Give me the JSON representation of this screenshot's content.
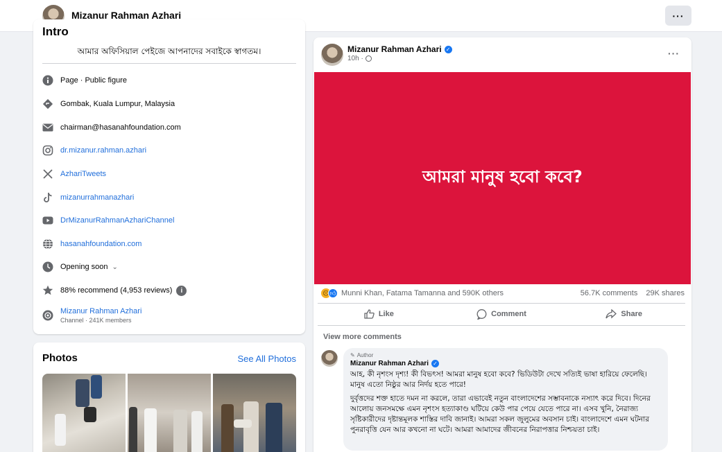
{
  "header": {
    "page_name": "Mizanur Rahman Azhari",
    "more_label": "···"
  },
  "intro": {
    "title": "Intro",
    "bio": "আমার অফিসিয়াল পেইজে আপনাদের সবাইকে স্বাগতম।",
    "items": [
      {
        "icon": "info-icon",
        "text": "Page · Public figure"
      },
      {
        "icon": "location-icon",
        "text": "Gombak, Kuala Lumpur, Malaysia"
      },
      {
        "icon": "mail-icon",
        "text": "chairman@hasanahfoundation.com"
      },
      {
        "icon": "instagram-icon",
        "text": "dr.mizanur.rahman.azhari"
      },
      {
        "icon": "x-icon",
        "text": "AzhariTweets"
      },
      {
        "icon": "tiktok-icon",
        "text": "mizanurrahmanazhari"
      },
      {
        "icon": "youtube-icon",
        "text": "DrMizanurRahmanAzhariChannel"
      },
      {
        "icon": "globe-icon",
        "text": "hasanahfoundation.com"
      },
      {
        "icon": "clock-icon",
        "text": "Opening soon"
      },
      {
        "icon": "star-icon",
        "text": "88% recommend (4,953 reviews)"
      },
      {
        "icon": "channel-icon",
        "text": "Mizanur Rahman Azhari",
        "sub": "Channel · 241K members"
      }
    ]
  },
  "photos": {
    "title": "Photos",
    "see_all": "See All Photos"
  },
  "post": {
    "author": "Mizanur Rahman Azhari",
    "time": "10h ·",
    "more_label": "···",
    "hero_text": "আমরা মানুষ হবো কবে?",
    "hero_color": "#dc143c",
    "reactions": "Munni Khan, Fatama Tamanna and 590K others",
    "comments_count": "56.7K comments",
    "shares_count": "29K shares",
    "actions": {
      "like": "Like",
      "comment": "Comment",
      "share": "Share"
    },
    "view_more": "View more comments"
  },
  "comment": {
    "tag": "Author",
    "author": "Mizanur Rahman Azhari",
    "p1": "আহ, কী নৃশংস দৃশ্য! কী বিভৎস! আমরা মানুষ হবো কবে? ভিডিউটা দেখে সত্যিই ভাষা হারিয়ে ফেলেছি। মানুষ এতো নিষ্ঠুর আর নির্দয় হতে পারে!",
    "p2": "দুর্বৃত্তদের শক্ত হাতে দমন না করলে, তারা এভাবেই নতুন বাংলাদেশের সম্ভাবনাকে নস্যাৎ করে দিবে। দিনের আলোয় জনসমক্ষে এমন নৃশংস হত্যাকাণ্ড ঘটিয়ে কেউ পার পেয়ে যেতে পারে না। এসব খুনি, নৈরাজ্য সৃষ্টিকারীদের দৃষ্টান্তমূলক শাস্তির দাবি জানাই। আমরা সকল জুলুমের অবসান চাই। বাংলাদেশে এমন ঘটনার পুনরাবৃত্তি যেন আর কখনো না ঘটে। আমরা আমাদের জীবনের নিরাপত্তার নিশ্চয়তা চাই।"
  }
}
